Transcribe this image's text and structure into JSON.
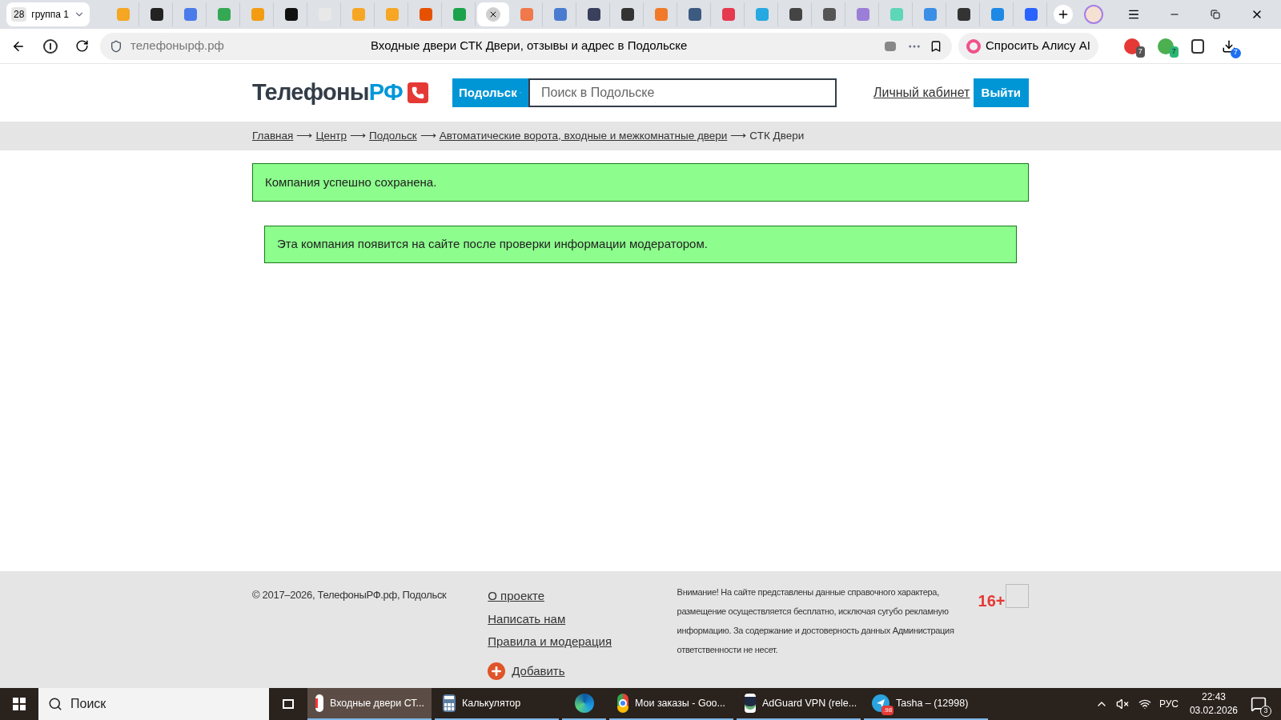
{
  "browser": {
    "tab_group": {
      "count": "28",
      "label": "группа 1"
    },
    "tabs": [
      {
        "selected": false
      },
      {
        "selected": false
      },
      {
        "selected": false
      },
      {
        "selected": false
      },
      {
        "selected": false
      },
      {
        "selected": false
      },
      {
        "selected": false
      },
      {
        "selected": false
      },
      {
        "selected": false
      },
      {
        "selected": false
      },
      {
        "selected": false
      },
      {
        "selected": true
      },
      {
        "selected": false
      },
      {
        "selected": false
      },
      {
        "selected": false
      },
      {
        "selected": false
      },
      {
        "selected": false
      },
      {
        "selected": false
      },
      {
        "selected": false
      },
      {
        "selected": false
      },
      {
        "selected": false
      },
      {
        "selected": false
      },
      {
        "selected": false
      },
      {
        "selected": false
      },
      {
        "selected": false
      },
      {
        "selected": false
      },
      {
        "selected": false
      },
      {
        "selected": false
      }
    ],
    "address": "телефонырф.рф",
    "page_title": "Входные двери СТК Двери, отзывы и адрес в Подольске",
    "alice_button": "Спросить Алису AI",
    "extension_badges": [
      "7",
      "7"
    ],
    "downloads_badge": "7"
  },
  "site": {
    "logo": {
      "text": "Телефоны",
      "accent": "РФ"
    },
    "city_button": "Подольск",
    "search": {
      "placeholder": "Поиск в Подольске"
    },
    "account_link": "Личный кабинет",
    "logout_button": "Выйти",
    "breadcrumbs": [
      {
        "label": "Главная",
        "link": true
      },
      {
        "label": "Центр",
        "link": true
      },
      {
        "label": "Подольск",
        "link": true
      },
      {
        "label": "Автоматические ворота, входные и межкомнатные двери",
        "link": true
      },
      {
        "label": "СТК Двери",
        "link": false
      }
    ],
    "separator": "⟶",
    "alerts": [
      "Компания успешно сохранена.",
      "Эта компания появится на сайте после проверки информации модератором."
    ],
    "footer": {
      "copyright": "© 2017–2026, ТелефоныРФ.рф, Подольск",
      "links": [
        "О проекте",
        "Написать нам",
        "Правила и модерация"
      ],
      "add_link": "Добавить",
      "disclaimer": "Внимание! На сайте представлены данные справочного характера, размещение осуществляется бесплатно, исключая сугубо рекламную информацию. За содержание и достоверность данных Администрация ответственности не несет.",
      "age": "16+"
    }
  },
  "taskbar": {
    "search": {
      "placeholder": "Поиск"
    },
    "apps": [
      {
        "kind": "yandex",
        "label": "Входные двери СТ...",
        "selected": true
      },
      {
        "kind": "calculator",
        "label": "Калькулятор",
        "selected": false
      },
      {
        "kind": "edge",
        "selected": false
      },
      {
        "kind": "chrome",
        "label": "Мои заказы - Goo...",
        "selected": false
      },
      {
        "kind": "adguard",
        "label": "AdGuard VPN (rele...",
        "selected": false
      },
      {
        "kind": "telegram",
        "label": "Tasha – (12998)",
        "badge": ".98",
        "selected": false
      }
    ],
    "language": "РУС",
    "time": "22:43",
    "date": "03.02.2026",
    "notifications": "3"
  }
}
